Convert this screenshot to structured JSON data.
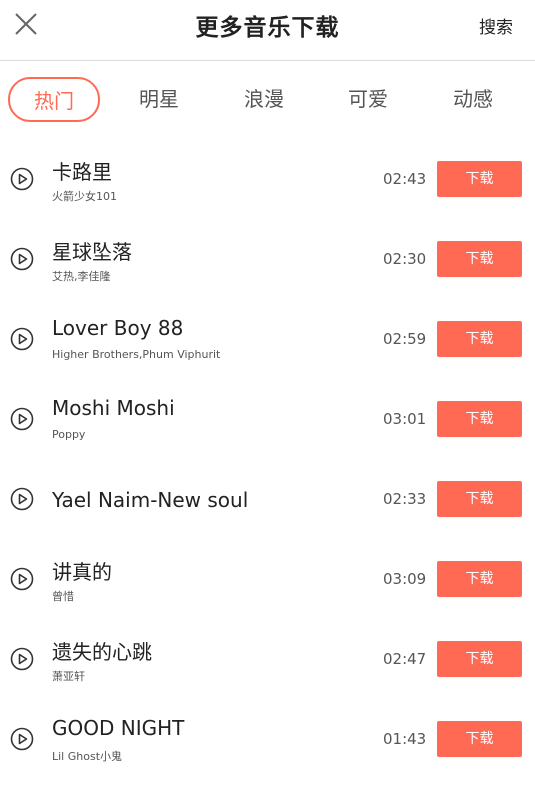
{
  "header": {
    "title": "更多音乐下载",
    "search_label": "搜索"
  },
  "tabs": [
    {
      "label": "热门",
      "active": true
    },
    {
      "label": "明星",
      "active": false
    },
    {
      "label": "浪漫",
      "active": false
    },
    {
      "label": "可爱",
      "active": false
    },
    {
      "label": "动感",
      "active": false
    }
  ],
  "songs": [
    {
      "title": "卡路里",
      "artist": "火箭少女101",
      "duration": "02:43",
      "download_label": "下载"
    },
    {
      "title": "星球坠落",
      "artist": "艾热,李佳隆",
      "duration": "02:30",
      "download_label": "下载"
    },
    {
      "title": "Lover Boy 88",
      "artist": "Higher Brothers,Phum Viphurit",
      "duration": "02:59",
      "download_label": "下载"
    },
    {
      "title": "Moshi Moshi",
      "artist": "Poppy",
      "duration": "03:01",
      "download_label": "下载"
    },
    {
      "title": "Yael Naim-New soul",
      "artist": "",
      "duration": "02:33",
      "download_label": "下载"
    },
    {
      "title": "讲真的",
      "artist": "曾惜",
      "duration": "03:09",
      "download_label": "下载"
    },
    {
      "title": "遗失的心跳",
      "artist": "萧亚轩",
      "duration": "02:47",
      "download_label": "下载"
    },
    {
      "title": "GOOD NIGHT",
      "artist": "Lil Ghost小鬼",
      "duration": "01:43",
      "download_label": "下载"
    }
  ],
  "colors": {
    "accent": "#ff6a55",
    "text": "#222222",
    "secondary_text": "#555555"
  },
  "icons": {
    "close": "close-icon",
    "play": "play-circle-icon"
  }
}
